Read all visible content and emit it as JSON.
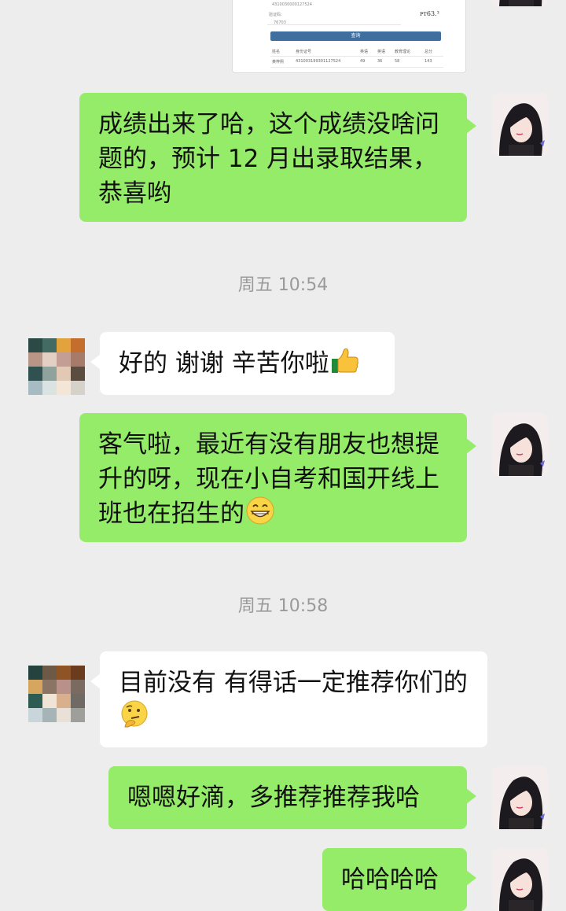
{
  "screenshot_card": {
    "label_a": "准考证号",
    "captcha_label": "验证码:",
    "captcha_value": "76703",
    "captcha_image": "ᴘᴛ63.³",
    "query_button": "查询",
    "table_headers": [
      "姓名",
      "身份证号",
      "英语",
      "英语",
      "教育理论",
      "总分"
    ],
    "table_row": [
      "黄梓熙",
      "431003199301127524",
      "49",
      "36",
      "58",
      "143"
    ]
  },
  "messages": [
    {
      "side": "right",
      "text": "成绩出来了哈，这个成绩没啥问题的，预计 12 月出录取结果，恭喜哟"
    },
    {
      "type": "time",
      "text": "周五 10:54"
    },
    {
      "side": "left",
      "text": "好的 谢谢 辛苦你啦",
      "emoji": "thumbs-up-icon"
    },
    {
      "side": "right",
      "text": "客气啦，最近有没有朋友也想提升的呀，现在小自考和国开线上班也在招生的",
      "emoji": "grin-icon"
    },
    {
      "type": "time",
      "text": "周五 10:58"
    },
    {
      "side": "left",
      "text": "目前没有 有得话一定推荐你们的",
      "emoji": "thinking-icon"
    },
    {
      "side": "right",
      "text": "嗯嗯好滴，多推荐推荐我哈"
    },
    {
      "side": "right",
      "text": "哈哈哈哈"
    }
  ],
  "colors": {
    "background": "#ededed",
    "my_bubble": "#95ec69",
    "their_bubble": "#ffffff",
    "timestamp_text": "#9a9a9a"
  }
}
